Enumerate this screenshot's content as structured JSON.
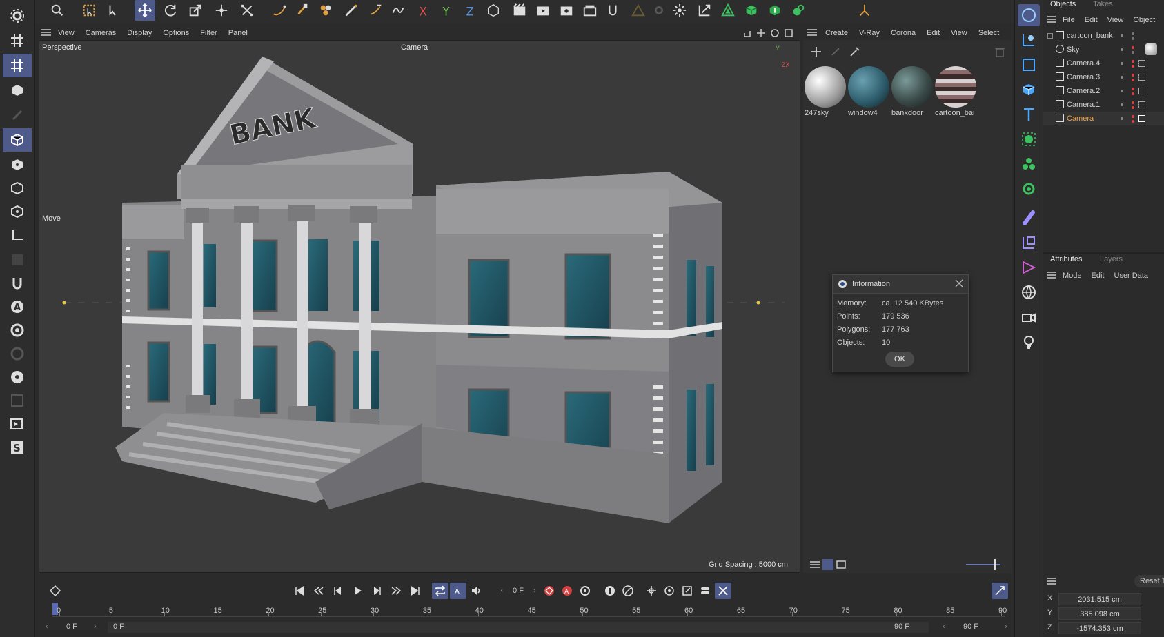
{
  "viewport": {
    "menu": [
      "View",
      "Cameras",
      "Display",
      "Options",
      "Filter",
      "Panel"
    ],
    "view_name": "Perspective",
    "camera_label": "Camera",
    "tool_label": "Move",
    "grid_spacing": "Grid Spacing : 5000 cm",
    "sign_text": "BANK",
    "axis_labels": {
      "y": "Y",
      "zx": "ZX"
    }
  },
  "materials": {
    "menu": [
      "Create",
      "V-Ray",
      "Corona",
      "Edit",
      "View",
      "Select"
    ],
    "items": [
      {
        "name": "247sky",
        "color": "#d8d8d8"
      },
      {
        "name": "window4",
        "color": "#2f5f6f"
      },
      {
        "name": "bankdoor",
        "color": "#3a4a48"
      },
      {
        "name": "cartoon_bai",
        "color": "#8a6a6a"
      }
    ]
  },
  "info_dialog": {
    "title": "Information",
    "rows": [
      {
        "label": "Memory:",
        "value": "ca. 12 540 KBytes"
      },
      {
        "label": "Points:",
        "value": "179 536"
      },
      {
        "label": "Polygons:",
        "value": "177 763"
      },
      {
        "label": "Objects:",
        "value": "10"
      }
    ],
    "ok_label": "OK"
  },
  "objects": {
    "tabs": [
      "Objects",
      "Takes"
    ],
    "menu": [
      "File",
      "Edit",
      "View",
      "Object"
    ],
    "items": [
      {
        "name": "cartoon_bank",
        "type": "null-icon"
      },
      {
        "name": "Sky",
        "type": "sky-icon"
      },
      {
        "name": "Camera.4",
        "type": "camera-icon"
      },
      {
        "name": "Camera.3",
        "type": "camera-icon"
      },
      {
        "name": "Camera.2",
        "type": "camera-icon"
      },
      {
        "name": "Camera.1",
        "type": "camera-icon"
      },
      {
        "name": "Camera",
        "type": "camera-icon",
        "active": true
      }
    ]
  },
  "attributes": {
    "tabs": [
      "Attributes",
      "Layers"
    ],
    "menu": [
      "Mode",
      "Edit",
      "User Data"
    ]
  },
  "coordinates": {
    "reset_label": "Reset T",
    "x_label": "X",
    "x_value": "2031.515 cm",
    "y_label": "Y",
    "y_value": "385.098 cm",
    "z_label": "Z",
    "z_value": "-1574.353 cm"
  },
  "timeline": {
    "current_frame": "0 F",
    "ticks": [
      "0",
      "5",
      "10",
      "15",
      "20",
      "25",
      "30",
      "35",
      "40",
      "45",
      "50",
      "55",
      "60",
      "65",
      "70",
      "75",
      "80",
      "85",
      "90"
    ],
    "start_field": "0 F",
    "range_start": "0 F",
    "range_end": "90 F",
    "end_field": "90 F"
  },
  "colors": {
    "accent": "#4e5a8a",
    "active_object": "#f0a040",
    "bank_wall": "#8a8a8d",
    "window_glass": "#1f5566"
  }
}
